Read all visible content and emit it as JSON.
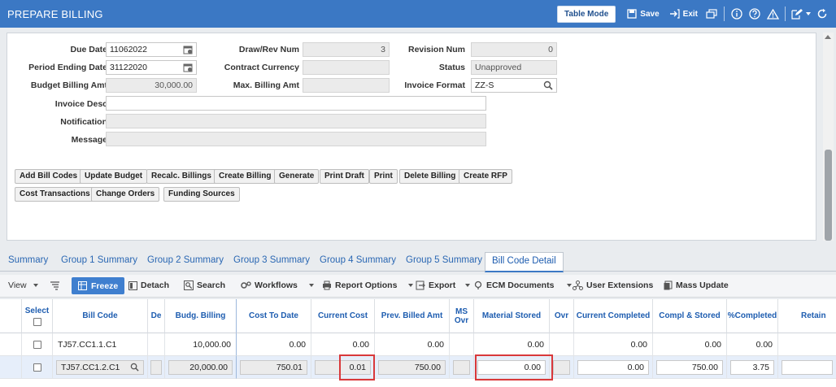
{
  "app": {
    "title": "PREPARE BILLING"
  },
  "titlebar": {
    "table_mode": "Table Mode",
    "save": "Save",
    "exit": "Exit"
  },
  "form": {
    "due_date": {
      "label": "Due Date",
      "value": "11062022"
    },
    "period_ending_date": {
      "label": "Period Ending Date",
      "value": "31122020"
    },
    "budget_billing_amt": {
      "label": "Budget Billing Amt",
      "value": "30,000.00"
    },
    "invoice_desc": {
      "label": "Invoice Desc",
      "value": ""
    },
    "notification": {
      "label": "Notification",
      "value": ""
    },
    "message": {
      "label": "Message",
      "value": ""
    },
    "draw_rev_num": {
      "label": "Draw/Rev Num",
      "value": "3"
    },
    "contract_currency": {
      "label": "Contract Currency",
      "value": ""
    },
    "max_billing_amt": {
      "label": "Max. Billing Amt",
      "value": ""
    },
    "revision_num": {
      "label": "Revision Num",
      "value": "0"
    },
    "status": {
      "label": "Status",
      "value": "Unapproved"
    },
    "invoice_format": {
      "label": "Invoice Format",
      "value": "ZZ-S"
    }
  },
  "actions": {
    "add_bill_codes": "Add Bill Codes",
    "update_budget": "Update Budget",
    "recalc_billings": "Recalc. Billings",
    "create_billing": "Create Billing",
    "generate": "Generate",
    "print_draft": "Print Draft",
    "print": "Print",
    "delete_billing": "Delete Billing",
    "create_rfp": "Create RFP",
    "cost_transactions": "Cost Transactions",
    "change_orders": "Change Orders",
    "funding_sources": "Funding Sources"
  },
  "tabs": [
    {
      "label": "Summary"
    },
    {
      "label": "Group 1 Summary"
    },
    {
      "label": "Group 2 Summary"
    },
    {
      "label": "Group 3 Summary"
    },
    {
      "label": "Group 4 Summary"
    },
    {
      "label": "Group 5 Summary"
    },
    {
      "label": "Bill Code Detail"
    }
  ],
  "toolbar": {
    "view": "View",
    "freeze": "Freeze",
    "detach": "Detach",
    "search": "Search",
    "workflows": "Workflows",
    "report_options": "Report Options",
    "export": "Export",
    "ecm_documents": "ECM Documents",
    "user_extensions": "User Extensions",
    "mass_update": "Mass Update"
  },
  "grid": {
    "columns": {
      "select": "Select",
      "bill_code": "Bill Code",
      "de": "De",
      "budg_billing": "Budg. Billing",
      "cost_to_date": "Cost To Date",
      "current_cost": "Current Cost",
      "prev_billed_amt": "Prev. Billed Amt",
      "ms_ovr": "MS Ovr",
      "material_stored": "Material Stored",
      "ovr": "Ovr",
      "current_completed": "Current Completed",
      "compl_stored": "Compl & Stored",
      "pct_completed": "%Completed",
      "retain": "Retain"
    },
    "rows": [
      {
        "bill_code": "TJ57.CC1.1.C1",
        "budg_billing": "10,000.00",
        "cost_to_date": "0.00",
        "current_cost": "0.00",
        "prev_billed_amt": "0.00",
        "material_stored": "0.00",
        "current_completed": "0.00",
        "compl_stored": "0.00",
        "pct_completed": "0.00"
      },
      {
        "bill_code": "TJ57.CC1.2.C1",
        "budg_billing": "20,000.00",
        "cost_to_date": "750.01",
        "current_cost": "0.01",
        "prev_billed_amt": "750.00",
        "material_stored": "0.00",
        "current_completed": "0.00",
        "compl_stored": "750.00",
        "pct_completed": "3.75"
      }
    ]
  },
  "colors": {
    "accent": "#3b78c4",
    "highlight": "#d9383a",
    "selected_row": "#e6eefa"
  }
}
